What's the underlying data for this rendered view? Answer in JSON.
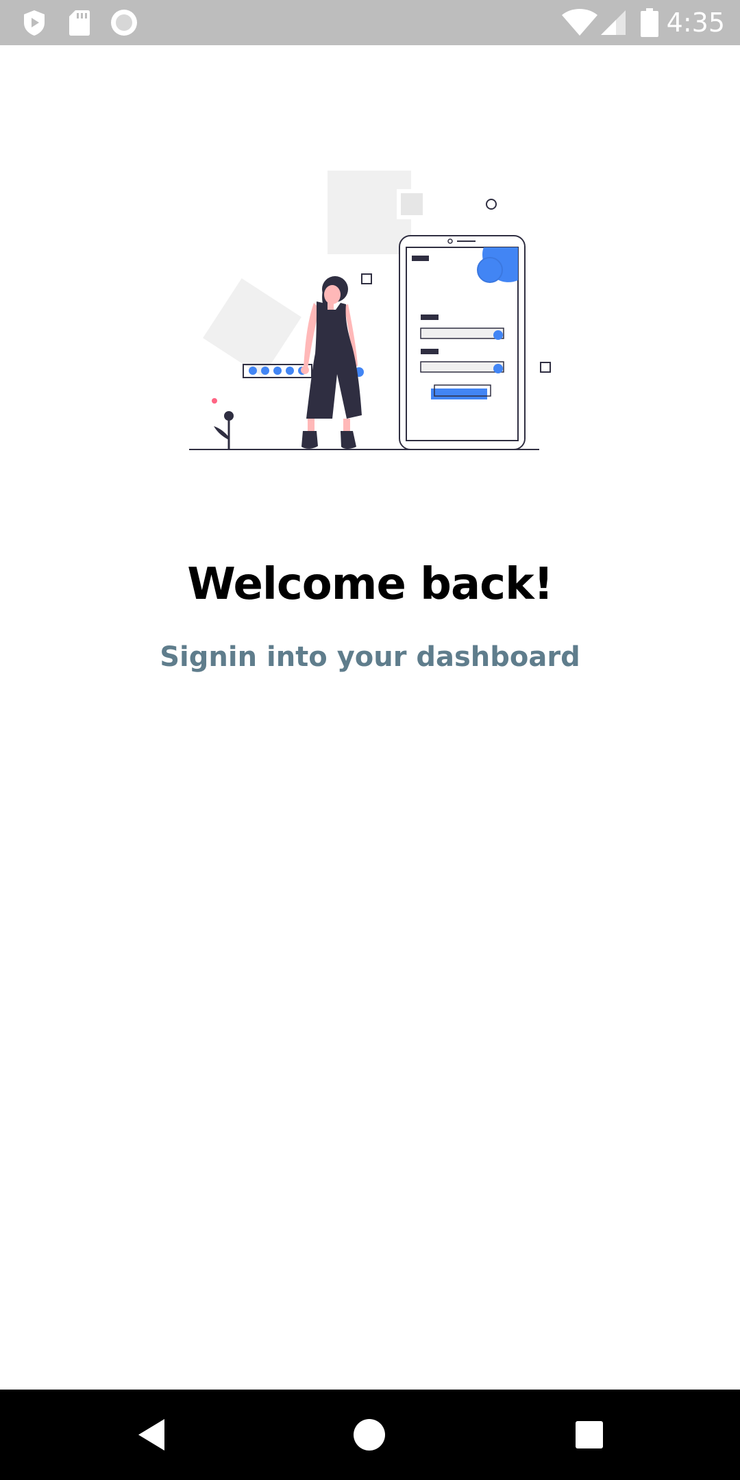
{
  "status_bar": {
    "time": "4:35",
    "left_icons": [
      "shield-icon",
      "sd-card-icon",
      "record-icon"
    ],
    "right_icons": [
      "wifi-icon",
      "signal-icon",
      "battery-icon"
    ]
  },
  "welcome": {
    "title": "Welcome back!",
    "subtitle": "Signin into your dashboard"
  },
  "nav_bar": {
    "buttons": [
      "back-icon",
      "home-icon",
      "recents-icon"
    ]
  },
  "colors": {
    "status_bar_bg": "#bdbdbd",
    "accent_blue": "#4285f4",
    "dark_figure": "#2f2e41",
    "subtitle": "#5f7d8c",
    "nav_bar_bg": "#000000"
  }
}
